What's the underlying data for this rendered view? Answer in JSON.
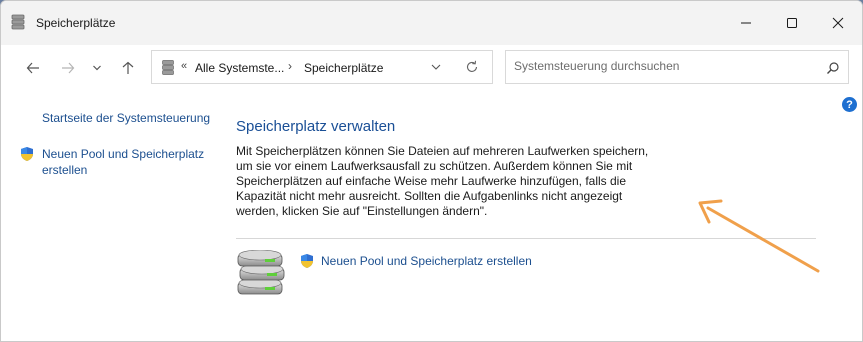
{
  "window": {
    "title": "Speicherplätze"
  },
  "addressbar": {
    "overflow_label": "«",
    "crumbs": [
      "Alle Systemste...",
      "Speicherplätze"
    ],
    "separator": "›"
  },
  "search": {
    "placeholder": "Systemsteuerung durchsuchen"
  },
  "help": {
    "label": "?"
  },
  "sidebar": {
    "home_link": "Startseite der Systemsteuerung",
    "create_pool_link": "Neuen Pool und Speicherplatz\nerstellen"
  },
  "main": {
    "title": "Speicherplatz verwalten",
    "description": "Mit Speicherplätzen können Sie Dateien auf mehreren Laufwerken speichern,\num sie vor einem Laufwerksausfall zu schützen. Außerdem können Sie mit\nSpeicherplätzen auf einfache Weise mehr Laufwerke hinzufügen, falls die\nKapazität nicht mehr ausreicht. Sollten die Aufgabenlinks nicht angezeigt\nwerden, klicken Sie auf \"Einstellungen ändern\".",
    "task_link": "Neuen Pool und Speicherplatz erstellen"
  },
  "colors": {
    "link": "#1c4f8f",
    "title": "#1a4f96",
    "annotation_arrow": "#f0a04b",
    "help_badge": "#1e6fd0"
  },
  "icons": {
    "title": "storage-spaces-icon",
    "back": "arrow-left-icon",
    "forward": "arrow-right-icon",
    "recent": "chevron-down-icon",
    "up": "arrow-up-icon",
    "address_dropdown": "chevron-down-icon",
    "refresh": "refresh-icon",
    "search": "search-icon",
    "shield": "uac-shield-icon",
    "drives": "storage-drives-icon"
  }
}
